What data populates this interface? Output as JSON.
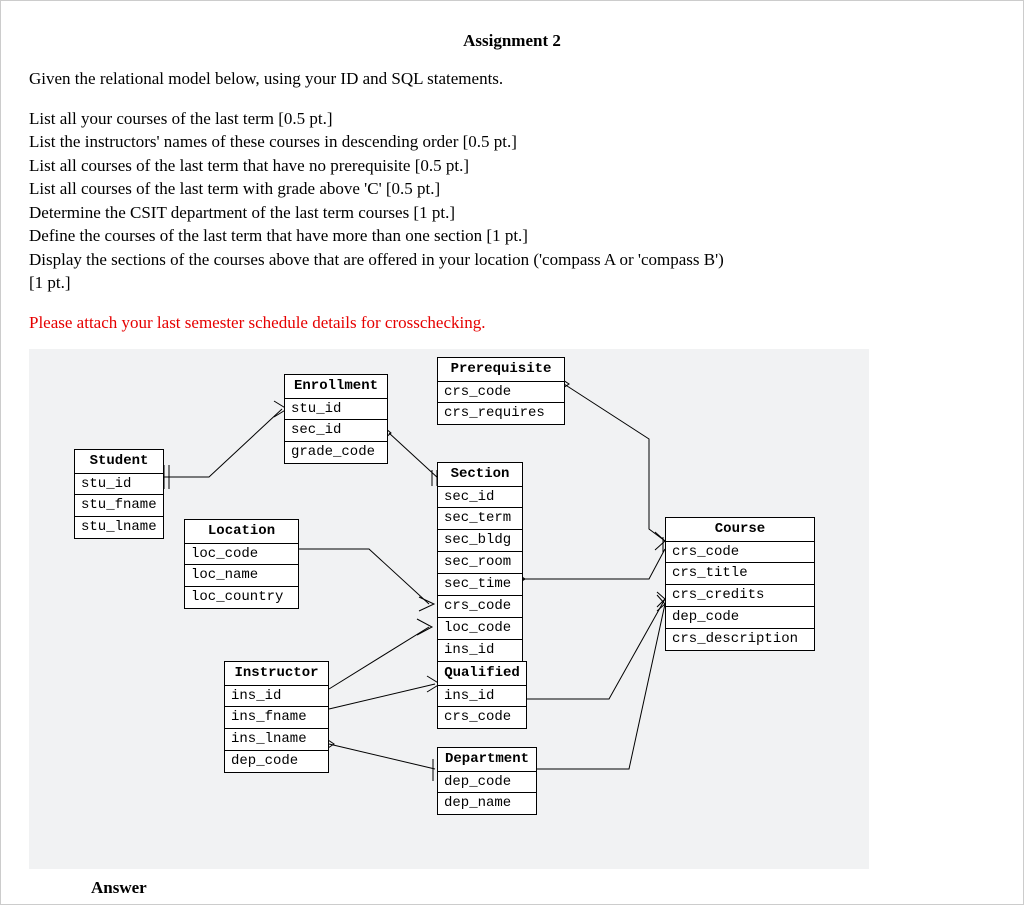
{
  "title": "Assignment 2",
  "intro": "Given the relational model below, using your ID and SQL statements.",
  "tasks": [
    "List all your courses of the last term [0.5 pt.]",
    "List the instructors' names of these courses in descending order [0.5 pt.]",
    "List all courses of the last term that have no prerequisite [0.5 pt.]",
    "List all courses of the last term with grade above 'C' [0.5 pt.]",
    "Determine the CSIT department of the last term courses [1 pt.]",
    "Define the courses of the last term that have more than one section [1 pt.]",
    "Display the sections of the courses above that are offered in your location ('compass A or 'compass B')",
    " [1 pt.]"
  ],
  "note": "Please attach your last semester schedule details for crosschecking.",
  "answer_heading": "Answer",
  "entities": {
    "student": {
      "name": "Student",
      "attrs": [
        "stu_id",
        "stu_fname",
        "stu_lname"
      ]
    },
    "enrollment": {
      "name": "Enrollment",
      "attrs": [
        "stu_id",
        "sec_id",
        "grade_code"
      ]
    },
    "prerequisite": {
      "name": "Prerequisite",
      "attrs": [
        "crs_code",
        "crs_requires"
      ]
    },
    "section": {
      "name": "Section",
      "attrs": [
        "sec_id",
        "sec_term",
        "sec_bldg",
        "sec_room",
        "sec_time",
        "crs_code",
        "loc_code",
        "ins_id"
      ]
    },
    "location": {
      "name": "Location",
      "attrs": [
        "loc_code",
        "loc_name",
        "loc_country"
      ]
    },
    "instructor": {
      "name": "Instructor",
      "attrs": [
        "ins_id",
        "ins_fname",
        "ins_lname",
        "dep_code"
      ]
    },
    "qualified": {
      "name": "Qualified",
      "attrs": [
        "ins_id",
        "crs_code"
      ]
    },
    "department": {
      "name": "Department",
      "attrs": [
        "dep_code",
        "dep_name"
      ]
    },
    "course": {
      "name": "Course",
      "attrs": [
        "crs_code",
        "crs_title",
        "crs_credits",
        "dep_code",
        "crs_description"
      ]
    }
  }
}
